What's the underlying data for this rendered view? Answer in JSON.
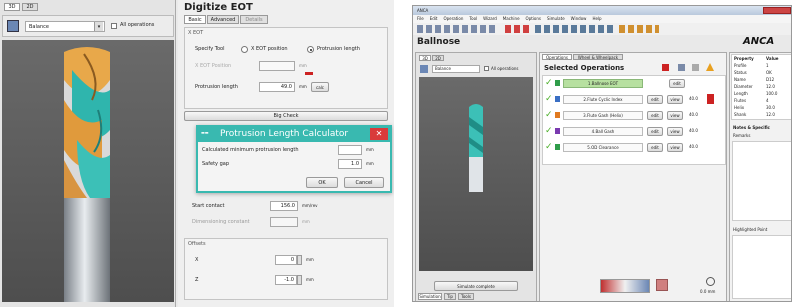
{
  "left": {
    "tabs": [
      "3D",
      "2D"
    ],
    "toolbar": {
      "view_select": "Balance",
      "check_label": "All operations"
    },
    "title": "Digitize EOT",
    "top_tabs": [
      "Basic",
      "Advanced",
      "Details"
    ],
    "section_eot": "X EOT",
    "specify_tool_label": "Specify Tool",
    "radio_position": "X EOT position",
    "radio_protrusion": "Protrusion length",
    "eot_position_label": "X EOT Position",
    "eot_position_unit": "mm",
    "protrusion_label": "Protrusion length",
    "protrusion_value": "49.0",
    "protrusion_unit": "mm",
    "protrusion_calc_btn": "calc",
    "big_check_btn": "Big Check",
    "dialog": {
      "title": "Protrusion Length Calculator",
      "close": "✕",
      "calc_label": "Calculated minimum protrusion length",
      "calc_unit": "mm",
      "safety_label": "Safety gap",
      "safety_value": "1.0",
      "safety_unit": "mm",
      "ok": "OK",
      "cancel": "Cancel"
    },
    "start_label": "Start contact",
    "start_value": "156.0",
    "start_unit": "mm/rev",
    "dim_label": "Dimensioning constant",
    "dim_unit": "mm",
    "offsets_title": "Offsets",
    "x_label": "X",
    "x_value": "0",
    "x_unit": "mm",
    "z_label": "Z",
    "z_value": "-1.0",
    "z_unit": "mm"
  },
  "right": {
    "title_bar": "ANCA",
    "menu": [
      "File",
      "Edit",
      "Operation",
      "Tool",
      "Wizard",
      "Machine",
      "Options",
      "Simulate",
      "Window",
      "Help"
    ],
    "heading": "Ballnose",
    "brand": "ANCA",
    "tabs": [
      "3D",
      "2D"
    ],
    "tool_tabs": [
      "Operations",
      "Wheel & Wheelpack"
    ],
    "view_select": "Balance",
    "check_label": "All operations",
    "selected_ops": "Selected Operations",
    "operations": [
      {
        "name": "1.Ballnose EOT"
      },
      {
        "name": "2.Flute Cyclic Index"
      },
      {
        "name": "3.Flute Gash (Helix)"
      },
      {
        "name": "4.Ball Gash"
      },
      {
        "name": "5.OD Clearance"
      }
    ],
    "row_buttons": [
      "edit",
      "view"
    ],
    "row_values": [
      "40.0",
      "40.0",
      "40.0",
      "40.0",
      "40.0"
    ],
    "props_header": "Property",
    "props_col": "Value",
    "props": [
      {
        "k": "Profile",
        "v": "1"
      },
      {
        "k": "Status",
        "v": "OK"
      },
      {
        "k": "Name",
        "v": "D12"
      },
      {
        "k": "Diameter",
        "v": "12.0"
      },
      {
        "k": "Length",
        "v": "100.0"
      },
      {
        "k": "Flutes",
        "v": "4"
      },
      {
        "k": "Helix",
        "v": "30.0"
      },
      {
        "k": "Shank",
        "v": "12.0"
      }
    ],
    "notes_title": "Notes & Specific",
    "remarks_title": "Remarks",
    "highlight_title": "Highlighted Point",
    "bottom_btn": "Simulate complete",
    "bottom_tabs": [
      "Simulation",
      "Tip",
      "Tools"
    ],
    "status_label": "0.0 mm"
  },
  "colors": {
    "accent_teal": "#39b9b0",
    "panel_bg": "#f0f0f0",
    "viewport_bg": "#5a5a5a",
    "green_op": "#b7e0a0",
    "check_green": "#4caf2a",
    "red": "#cc2222"
  }
}
